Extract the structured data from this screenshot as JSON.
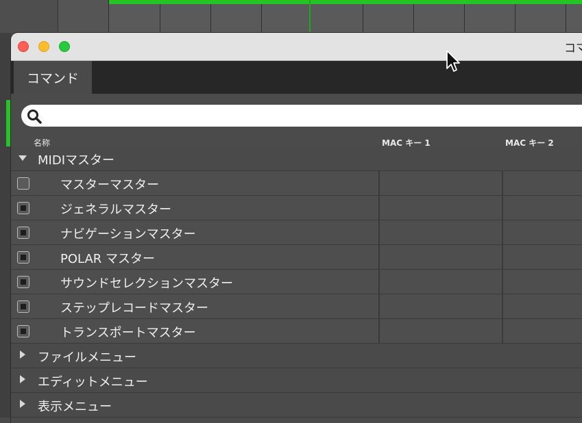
{
  "window": {
    "title": "コマ"
  },
  "tabs": [
    {
      "label": "コマンド"
    }
  ],
  "search": {
    "value": "",
    "placeholder": ""
  },
  "columns": {
    "name": "名称",
    "key1": "MAC キー 1",
    "key2": "MAC キー 2"
  },
  "rows": [
    {
      "type": "group",
      "label": "MIDIマスター",
      "expanded": true
    },
    {
      "type": "item",
      "label": "マスターマスター",
      "checkbox": "empty"
    },
    {
      "type": "item",
      "label": "ジェネラルマスター",
      "checkbox": "mixed"
    },
    {
      "type": "item",
      "label": "ナビゲーションマスター",
      "checkbox": "mixed"
    },
    {
      "type": "item",
      "label": "POLAR マスター",
      "checkbox": "mixed"
    },
    {
      "type": "item",
      "label": "サウンドセレクションマスター",
      "checkbox": "mixed"
    },
    {
      "type": "item",
      "label": "ステップレコードマスター",
      "checkbox": "mixed"
    },
    {
      "type": "item",
      "label": "トランスポートマスター",
      "checkbox": "mixed"
    },
    {
      "type": "group",
      "label": "ファイルメニュー",
      "expanded": false
    },
    {
      "type": "group",
      "label": "エディットメニュー",
      "expanded": false
    },
    {
      "type": "group",
      "label": "表示メニュー",
      "expanded": false
    }
  ],
  "colors": {
    "accent_green": "#23c423",
    "close": "#fe5f57",
    "minimize": "#febc2e",
    "maximize": "#28c840"
  },
  "icons": {
    "search": "magnifier-icon",
    "cursor": "arrow-cursor-icon"
  }
}
